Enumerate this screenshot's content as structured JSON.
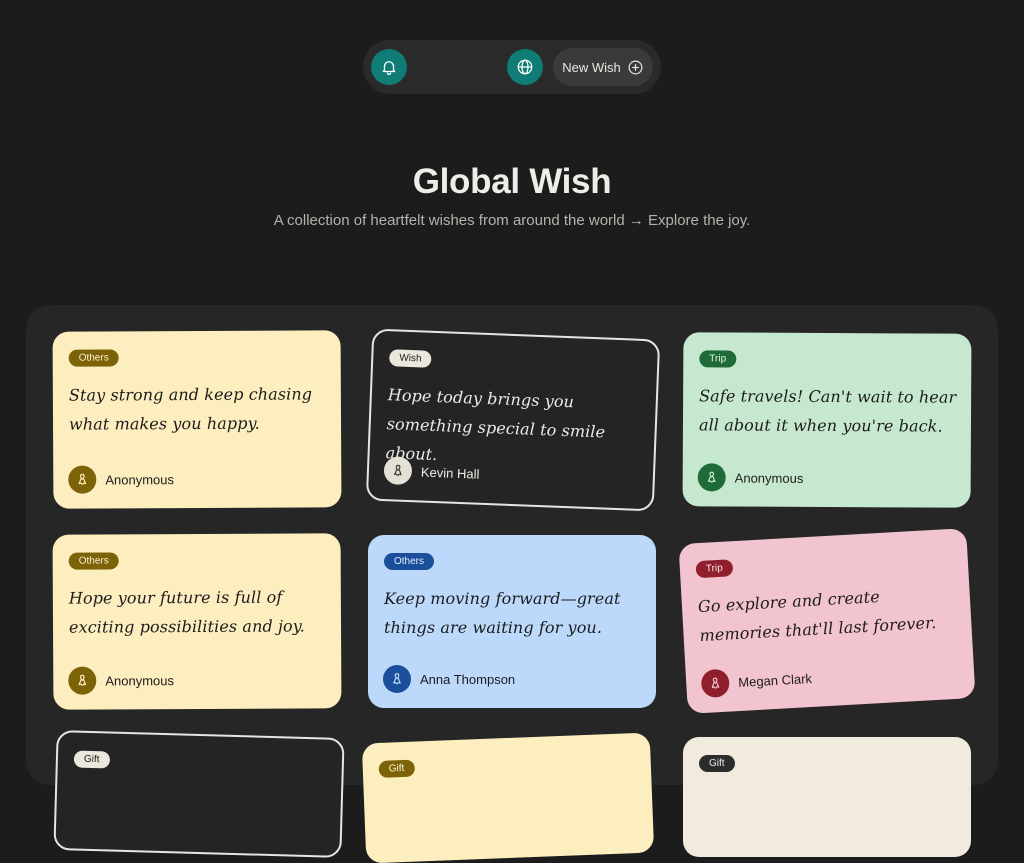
{
  "nav": {
    "new_wish_label": "New Wish",
    "icons": [
      "bell-icon",
      "globe-icon",
      "plus-circle-icon"
    ]
  },
  "hero": {
    "title": "Global Wish",
    "subtitle": "A collection of heartfelt wishes from around the world → Explore the joy."
  },
  "colors": {
    "background": "#1c1c1c",
    "accent_teal": "#0f7c76",
    "card_yellow": "#fdeebf",
    "card_green": "#c6e8cf",
    "card_blue": "#bcd9fb",
    "card_pink": "#f2c4cf",
    "card_dark": "#242424",
    "card_cream": "#f1ebde"
  },
  "cards": [
    {
      "tag": "Others",
      "message": "Stay strong and keep chasing what makes you happy.",
      "author": "Anonymous"
    },
    {
      "tag": "Wish",
      "message": "Hope today brings you something special to smile about.",
      "author": "Kevin Hall"
    },
    {
      "tag": "Trip",
      "message": "Safe travels! Can't wait to hear all about it when you're back.",
      "author": "Anonymous"
    },
    {
      "tag": "Others",
      "message": "Hope your future is full of exciting possibilities and joy.",
      "author": "Anonymous"
    },
    {
      "tag": "Others",
      "message": "Keep moving forward—great things are waiting for you.",
      "author": "Anna Thompson"
    },
    {
      "tag": "Trip",
      "message": "Go explore and create memories that'll last forever.",
      "author": "Megan Clark"
    },
    {
      "tag": "Gift"
    },
    {
      "tag": "Gift"
    },
    {
      "tag": "Gift"
    }
  ]
}
